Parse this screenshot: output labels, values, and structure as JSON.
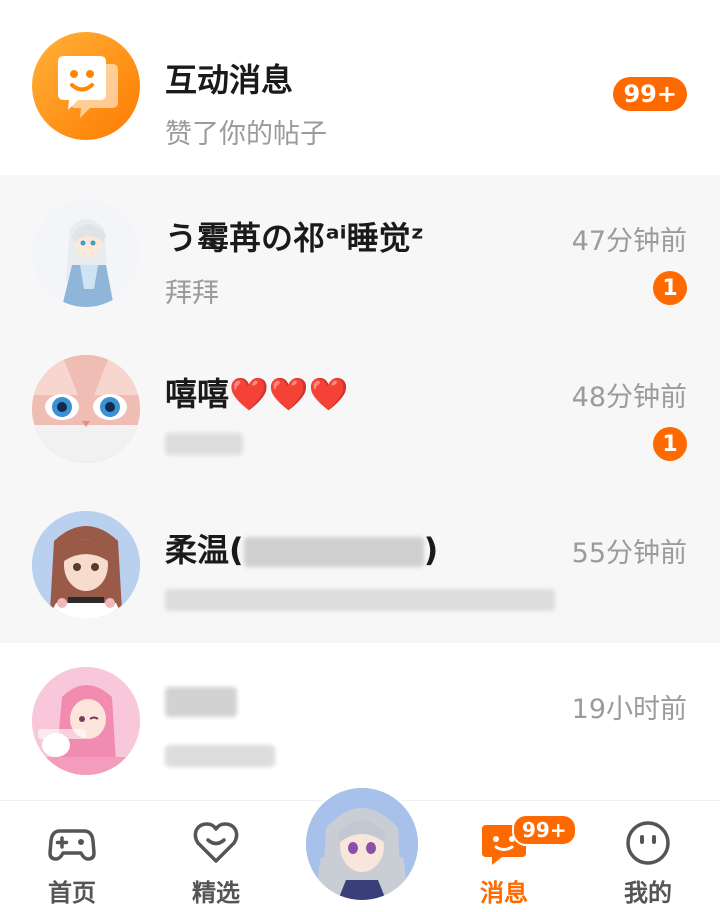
{
  "notifications": {
    "title": "互动消息",
    "subtitle": "赞了你的帖子",
    "badge": "99+"
  },
  "conversations": [
    {
      "name": "う霉苒の祁ᵃⁱ睡觉ᶻ",
      "preview": "拜拜",
      "time": "47分钟前",
      "unread": "1"
    },
    {
      "name": "嘻嘻❤️❤️❤️",
      "preview": "",
      "time": "48分钟前",
      "unread": "1"
    },
    {
      "name": "柔温(",
      "name_suffix": ")",
      "preview": "",
      "time": "55分钟前",
      "unread": ""
    },
    {
      "name": "",
      "preview": "",
      "time": "19小时前",
      "unread": ""
    }
  ],
  "tabbar": {
    "home": "首页",
    "featured": "精选",
    "messages": "消息",
    "messages_badge": "99+",
    "me": "我的"
  },
  "colors": {
    "accent": "#ff6a00",
    "row_gray": "#f7f7f7"
  }
}
